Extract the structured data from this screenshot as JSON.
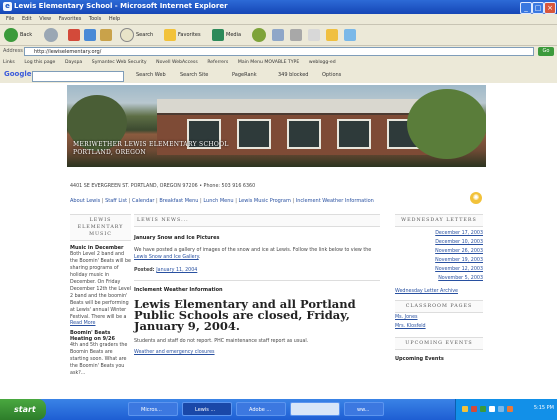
{
  "window": {
    "title": "Lewis Elementary School - Microsoft Internet Explorer"
  },
  "menu": [
    "File",
    "Edit",
    "View",
    "Favorites",
    "Tools",
    "Help"
  ],
  "toolbar": {
    "back": "Back",
    "search": "Search",
    "favorites": "Favorites",
    "media": "Media"
  },
  "address": {
    "label": "Address",
    "url": "http://lewiselementary.org/",
    "go": "Go"
  },
  "links": {
    "label": "Links",
    "items": [
      "Log this page",
      "Dayspa",
      "Symantec Web Security",
      "Novell WebAccess",
      "Referrers",
      "Main Menu MOVABLE TYPE",
      "weblogg-ed"
    ]
  },
  "google": {
    "logo": "Google",
    "search_web": "Search Web",
    "search_site": "Search Site",
    "pagerank": "PageRank",
    "blocked": "349 blocked",
    "options": "Options"
  },
  "page": {
    "school_name": "MERIWETHER LEWIS ELEMENTARY SCHOOL",
    "school_city": "PORTLAND, OREGON",
    "address_line": "4401 SE EVERGREEN ST. PORTLAND, OREGON 97206 • Phone: 503 916 6360",
    "nav": [
      "About Lewis",
      "Staff List",
      "Calendar",
      "Breakfast Menu",
      "Lunch Menu",
      "Lewis Music Program",
      "Inclement Weather Information"
    ],
    "left": {
      "head": "LEWIS ELEMENTARY MUSIC",
      "h1": "Music in December",
      "p1": "Both Level 2 band and the Boomin' Beats will be sharing programs of holiday music in December. On Friday December 12th the Level 2 band and the boomin' Beats will be performing at Lewis' annual Winter Festival. There will be a",
      "read_more": "Read More",
      "h2": "Boomin' Beats Heating on 9/26",
      "p2": "4th and 5th graders the Boomin Beats are starting soon. What are the Boomin' Beats you ask?..."
    },
    "main": {
      "head": "LEWIS NEWS...",
      "h1": "January Snow and Ice Pictures",
      "p1a": "We have posted a gallery of images of the snow and ice at Lewis. Follow the link below to view the ",
      "p1link": "Lewis Snow and Ice Gallery",
      "posted_label": "Posted: ",
      "posted_date": "January 11, 2004",
      "h2": "Inclement Weather Information",
      "big": "Lewis Elementary and all Portland Public Schools are closed, Friday, January 9, 2004.",
      "p2": "Students and staff do not report. PHC maintenance staff report as usual.",
      "p3link": "Weather and emergency closures"
    },
    "right": {
      "head1": "WEDNESDAY LETTERS",
      "letters": [
        "December 17, 2003",
        "December 10, 2003",
        "November 26, 2003",
        "November 19, 2003",
        "November 12, 2003",
        "November 5, 2003"
      ],
      "archive": "Wednesday Letter Archive",
      "head2": "CLASSROOM PAGES",
      "classes": [
        "Ms. Jones",
        "Mrs. Klosfeld"
      ],
      "head3": "UPCOMING EVENTS",
      "upcoming": "Upcoming Events"
    }
  },
  "taskbar": {
    "start": "start",
    "tasks": [
      "Micros...",
      "Lewis ...",
      "Adobe ...",
      "",
      "ww..."
    ],
    "clock": "5:15 PM"
  },
  "colors": {
    "titlebar": "#1546b6",
    "taskbar": "#1e5ed3",
    "start": "#2d7d2a",
    "link": "#2850a0"
  }
}
